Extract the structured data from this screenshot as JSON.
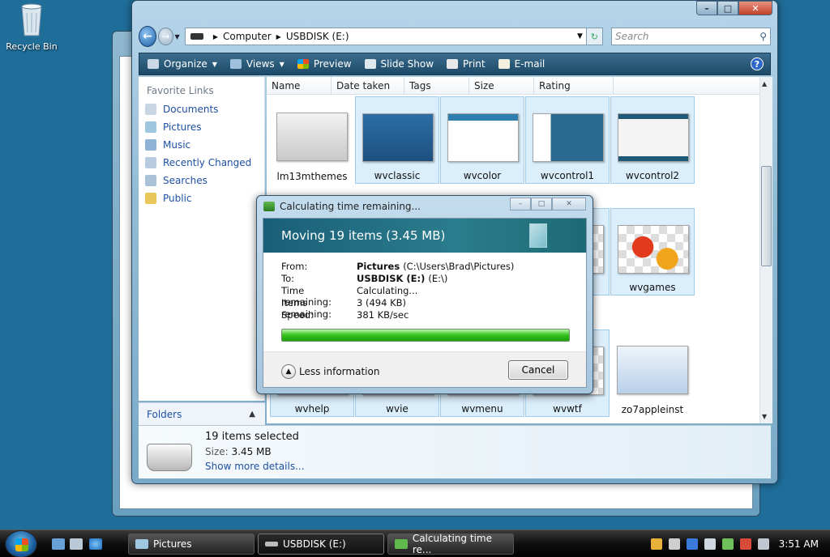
{
  "desktop": {
    "recycle_bin": "Recycle Bin"
  },
  "explorer": {
    "address": {
      "computer": "Computer",
      "drive": "USBDISK (E:)"
    },
    "search_placeholder": "Search",
    "toolbar": {
      "organize": "Organize",
      "views": "Views",
      "preview": "Preview",
      "slideshow": "Slide Show",
      "print": "Print",
      "email": "E-mail"
    },
    "favorite_links": {
      "title": "Favorite Links",
      "items": [
        "Documents",
        "Pictures",
        "Music",
        "Recently Changed",
        "Searches",
        "Public"
      ]
    },
    "folders_label": "Folders",
    "columns": [
      "Name",
      "Date taken",
      "Tags",
      "Size",
      "Rating"
    ],
    "thumbnails": [
      {
        "label": "lm13mthemes"
      },
      {
        "label": "wvclassic"
      },
      {
        "label": "wvcolor"
      },
      {
        "label": "wvcontrol1"
      },
      {
        "label": "wvcontrol2"
      },
      {
        "label": "wvgames"
      },
      {
        "label": "wvhelp"
      },
      {
        "label": "wvie"
      },
      {
        "label": "wvmenu"
      },
      {
        "label": "wvwtf"
      },
      {
        "label": "zo7appleinst"
      }
    ],
    "details": {
      "selected": "19 items selected",
      "size_label": "Size:",
      "size_value": "3.45 MB",
      "more": "Show more details..."
    }
  },
  "dialog": {
    "title": "Calculating time remaining...",
    "header": "Moving 19 items (3.45 MB)",
    "rows": {
      "from_label": "From:",
      "from_bold": "Pictures",
      "from_rest": "(C:\\Users\\Brad\\Pictures)",
      "to_label": "To:",
      "to_bold": "USBDISK (E:)",
      "to_rest": "(E:\\)",
      "time_label": "Time remaining:",
      "time_value": "Calculating...",
      "items_label": "Items remaining:",
      "items_value": "3 (494 KB)",
      "speed_label": "Speed:",
      "speed_value": "381 KB/sec"
    },
    "progress": 1.0,
    "less_info": "Less information",
    "cancel": "Cancel"
  },
  "taskbar": {
    "tasks": [
      "Pictures",
      "USBDISK (E:)",
      "Calculating time re..."
    ],
    "clock": "3:51 AM"
  }
}
